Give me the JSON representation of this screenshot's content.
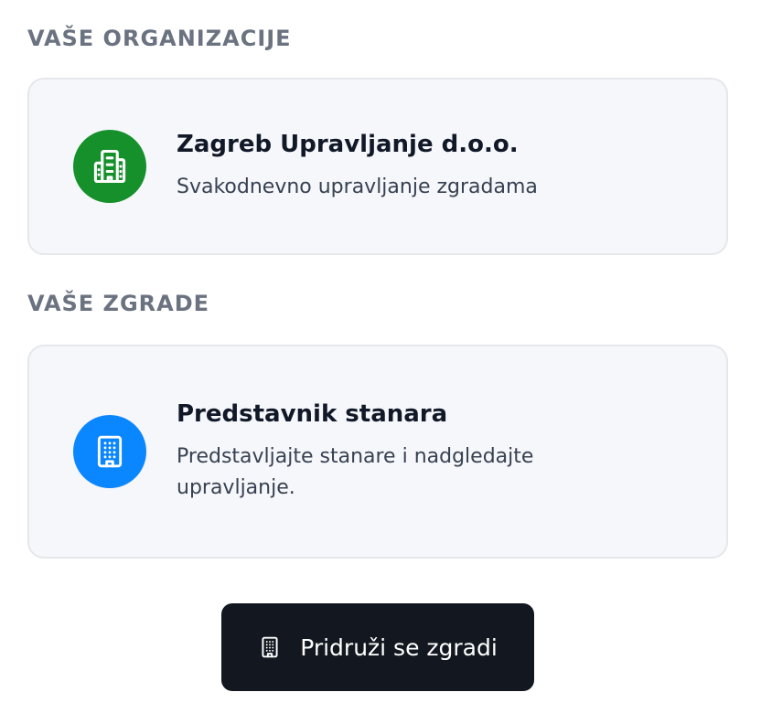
{
  "sections": {
    "organizations": {
      "heading": "VAŠE ORGANIZACIJE",
      "cards": [
        {
          "title": "Zagreb Upravljanje d.o.o.",
          "subtitle": "Svakodnevno upravljanje zgradama",
          "icon": "office-building-icon",
          "icon_bg": "#15902b"
        }
      ]
    },
    "buildings": {
      "heading": "VAŠE ZGRADE",
      "cards": [
        {
          "title": "Predstavnik stanara",
          "subtitle": "Predstavljajte stanare i nadgledajte upravljanje.",
          "icon": "building-icon",
          "icon_bg": "#0a86ff"
        }
      ]
    }
  },
  "actions": {
    "join_button": {
      "label": "Pridruži se zgradi",
      "icon": "building-icon",
      "bg": "#131820"
    }
  }
}
